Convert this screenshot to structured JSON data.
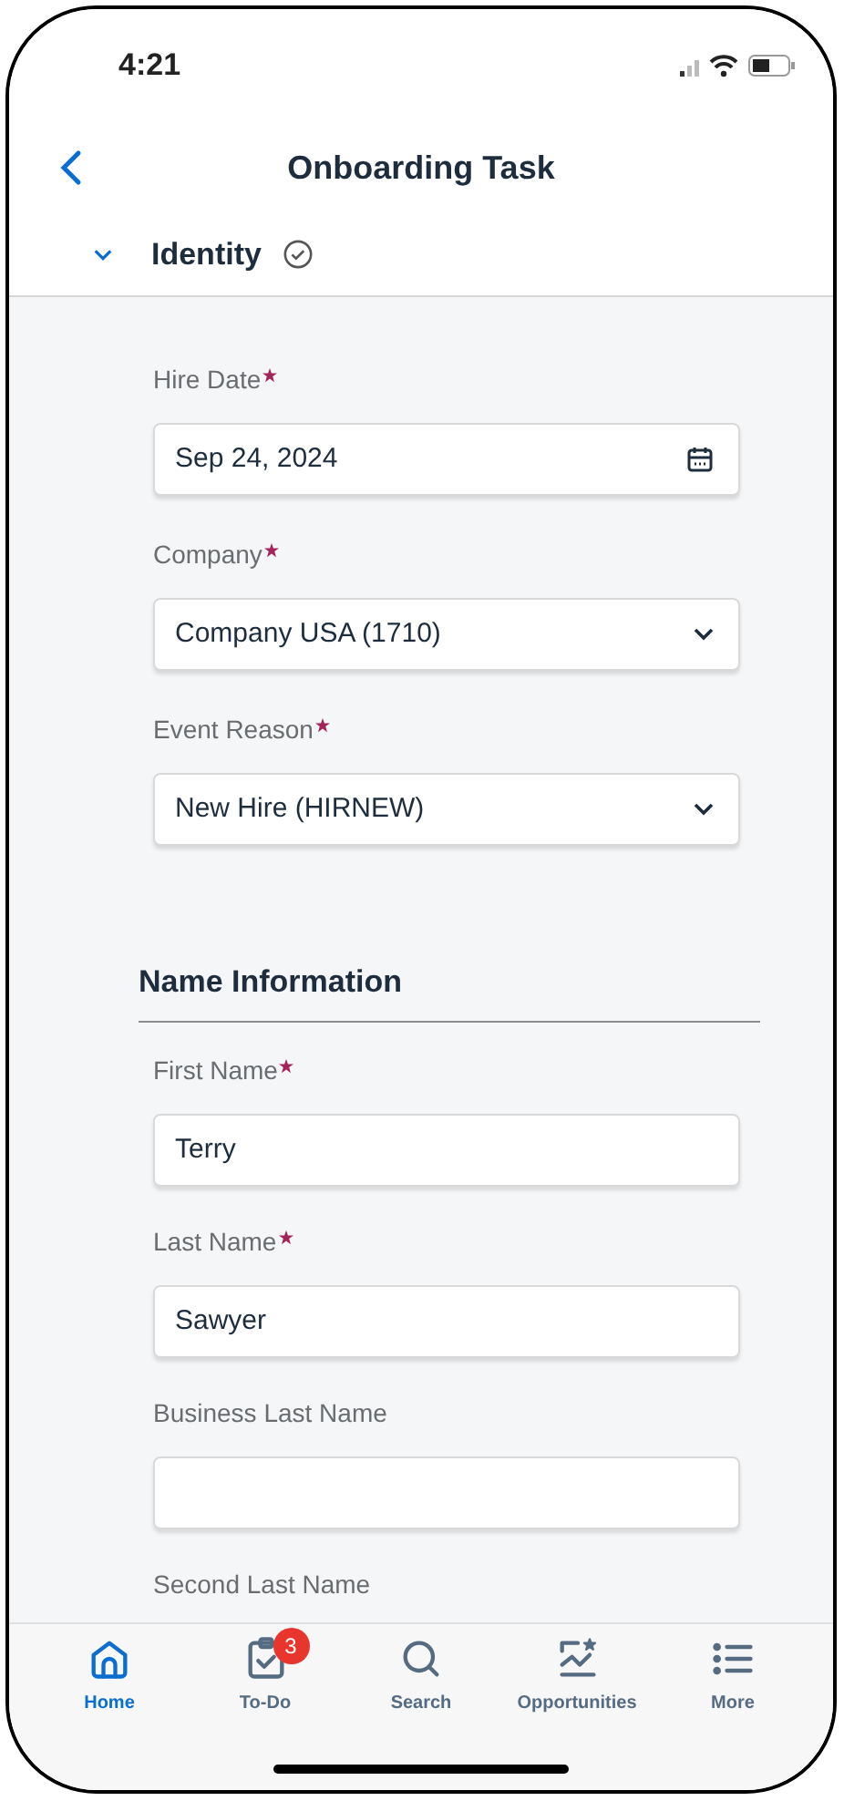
{
  "status_bar": {
    "time": "4:21"
  },
  "header": {
    "title": "Onboarding Task"
  },
  "section": {
    "title": "Identity",
    "expanded": true,
    "complete": true
  },
  "fields": [
    {
      "label": "Hire Date",
      "required": true,
      "kind": "date",
      "value": "Sep 24, 2024"
    },
    {
      "label": "Company",
      "required": true,
      "kind": "select",
      "value": "Company USA (1710)"
    },
    {
      "label": "Event Reason",
      "required": true,
      "kind": "select",
      "value": "New Hire (HIRNEW)"
    }
  ],
  "subsection": {
    "title": "Name Information"
  },
  "name_fields": [
    {
      "label": "First Name",
      "required": true,
      "kind": "text",
      "value": "Terry"
    },
    {
      "label": "Last Name",
      "required": true,
      "kind": "text",
      "value": "Sawyer"
    },
    {
      "label": "Business Last Name",
      "required": false,
      "kind": "text"
    },
    {
      "label": "Second Last Name",
      "required": false,
      "kind": "cut"
    }
  ],
  "tab_bar": [
    {
      "label": "Home",
      "kind": "home",
      "selected": true
    },
    {
      "label": "To-Do",
      "kind": "todo",
      "selected": false,
      "badge": "3"
    },
    {
      "label": "Search",
      "kind": "search",
      "selected": false
    },
    {
      "label": "Opportunities",
      "kind": "chart",
      "selected": false
    },
    {
      "label": "More",
      "kind": "list",
      "selected": false
    }
  ]
}
